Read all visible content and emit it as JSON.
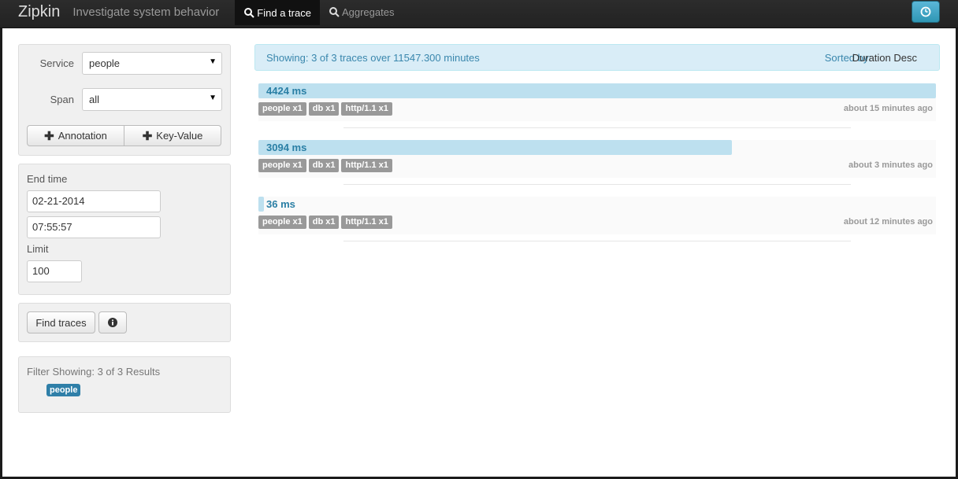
{
  "navbar": {
    "brand": "Zipkin",
    "tagline": "Investigate system behavior",
    "tabs": [
      {
        "label": "Find a trace",
        "icon": "search-icon",
        "active": true
      },
      {
        "label": "Aggregates",
        "icon": "search-icon",
        "active": false
      }
    ],
    "right_button_icon": "clock-icon",
    "colors": {
      "accent": "#2f96b4"
    }
  },
  "search": {
    "service_label": "Service",
    "service_value": "people",
    "span_label": "Span",
    "span_value": "all",
    "annotation_label": "Annotation",
    "keyvalue_label": "Key-Value"
  },
  "time": {
    "end_time_label": "End time",
    "date_value": "02-21-2014",
    "time_value": "07:55:57",
    "limit_label": "Limit",
    "limit_value": "100"
  },
  "actions": {
    "find_label": "Find traces",
    "info_icon": "info-icon"
  },
  "filter": {
    "text": "Filter Showing: 3 of 3 Results",
    "badge": "people"
  },
  "results": {
    "showing": "Showing: 3 of 3 traces over 11547.300 minutes",
    "sorted_label": "Sorted by:",
    "sorted_value": "Duration Desc",
    "traces": [
      {
        "duration": "4424 ms",
        "fraction": 1.0,
        "tags": [
          "people x1",
          "db x1",
          "http/1.1 x1"
        ],
        "ago": "about 15 minutes ago"
      },
      {
        "duration": "3094 ms",
        "fraction": 0.699,
        "tags": [
          "people x1",
          "db x1",
          "http/1.1 x1"
        ],
        "ago": "about 3 minutes ago"
      },
      {
        "duration": "36 ms",
        "fraction": 0.008,
        "tags": [
          "people x1",
          "db x1",
          "http/1.1 x1"
        ],
        "ago": "about 12 minutes ago"
      }
    ]
  }
}
